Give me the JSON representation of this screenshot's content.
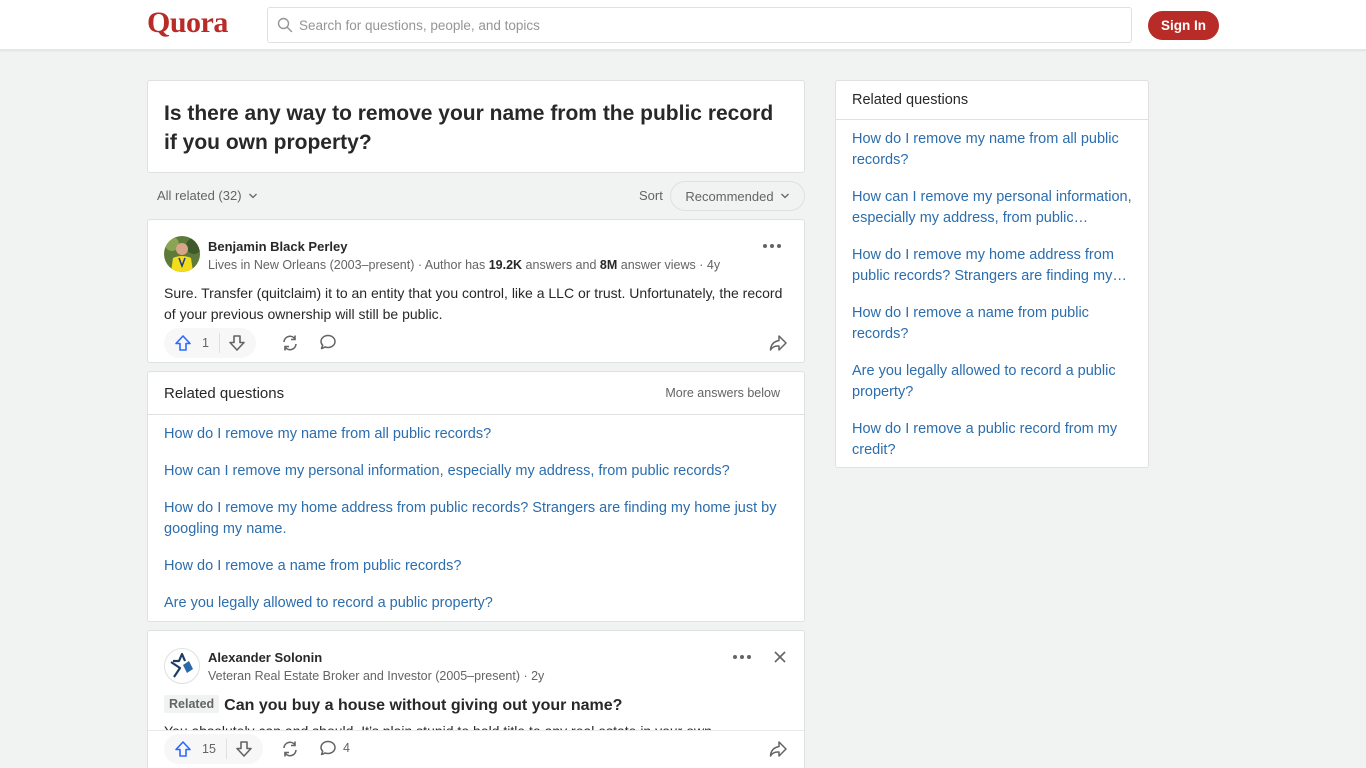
{
  "header": {
    "logo": "Quora",
    "search_placeholder": "Search for questions, people, and topics",
    "signin_label": "Sign In",
    "brand_color": "#b92b27"
  },
  "question": {
    "title": "Is there any way to remove your name from the public record if you own property?"
  },
  "filters": {
    "all_related": "All related (32)",
    "sort_label": "Sort",
    "sort_value": "Recommended"
  },
  "answers": [
    {
      "author": "Benjamin Black Perley",
      "credential_prefix": "Lives in New Orleans (2003–present) · Author has ",
      "answers_count": "19.2K",
      "credential_mid": " answers and ",
      "views_count": "8M",
      "credential_suffix": " answer views · 4y",
      "text": "Sure. Transfer (quitclaim) it to an entity that you control, like a LLC or trust. Unfortunately, the record of your previous ownership will still be public.",
      "upvotes": "1",
      "comments": ""
    },
    {
      "author": "Alexander Solonin",
      "credential": "Veteran Real Estate Broker and Investor (2005–present) · 2y",
      "related_tag": "Related",
      "related_question": "Can you buy a house without giving out your name?",
      "text": "You absolutely can and should. It’s plain stupid to hold title to any real estate in your own",
      "upvotes": "15",
      "comments": "4"
    }
  ],
  "related_inline": {
    "title": "Related questions",
    "more_below": "More answers below",
    "items": [
      "How do I remove my name from all public records?",
      "How can I remove my personal information, especially my address, from public records?",
      "How do I remove my home address from public records? Strangers are finding my home just by googling my name.",
      "How do I remove a name from public records?",
      "Are you legally allowed to record a public property?"
    ]
  },
  "sidebar": {
    "title": "Related questions",
    "items": [
      "How do I remove my name from all public records?",
      "How can I remove my personal information, especially my address, from public records?",
      "How do I remove my home address from public records? Strangers are finding my home just by googling my name.",
      "How do I remove a name from public records?",
      "Are you legally allowed to record a public property?",
      "How do I remove a public record from my credit?"
    ]
  }
}
